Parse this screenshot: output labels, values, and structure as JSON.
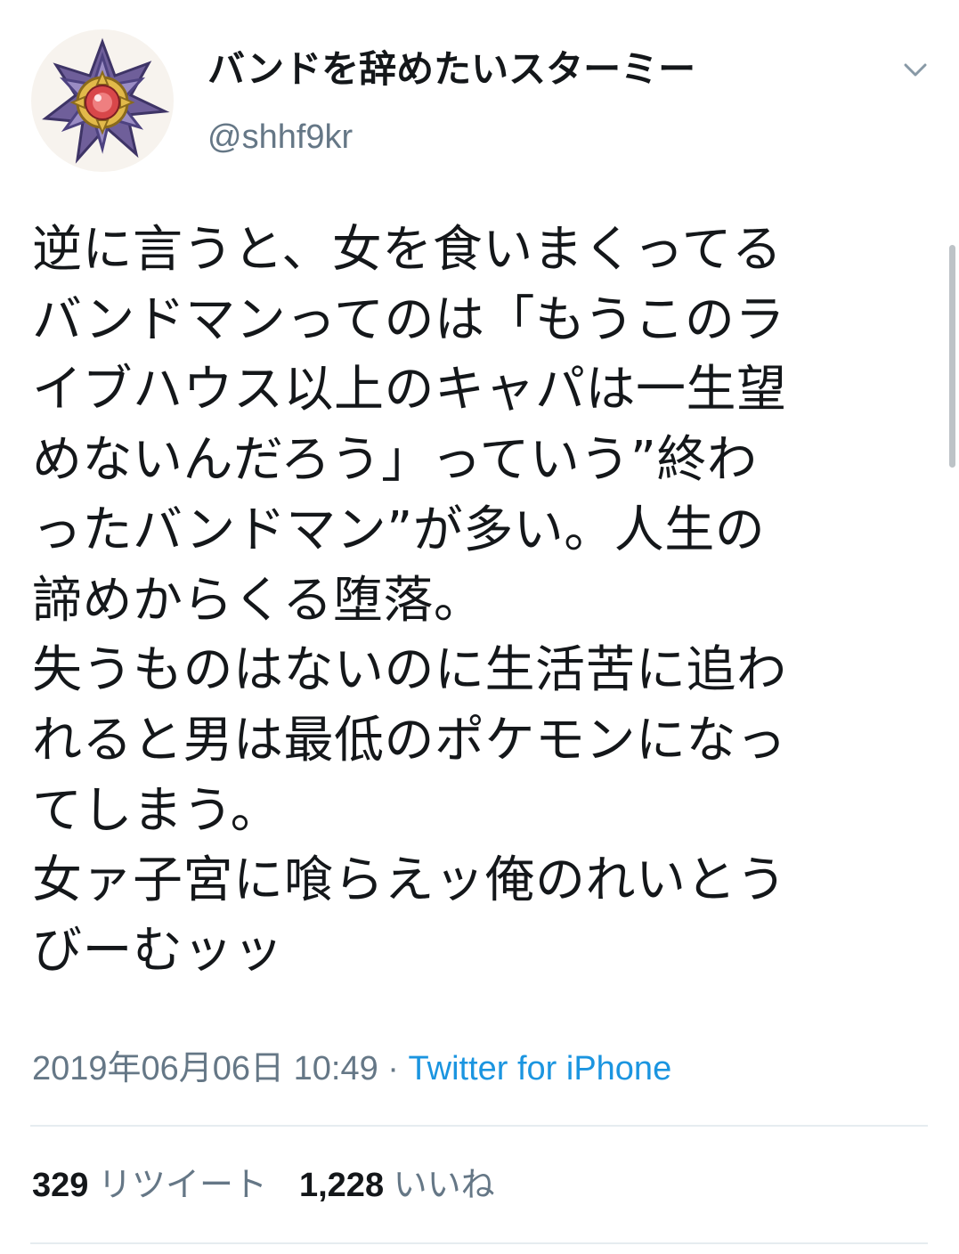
{
  "user": {
    "display_name": "バンドを辞めたいスターミー",
    "handle": "@shhf9kr",
    "avatar": "starmie-avatar"
  },
  "menu": {
    "icon": "chevron-down-icon"
  },
  "tweet": {
    "lines": [
      "逆に言うと、女を食いまくってる",
      "バンドマンってのは「もうこのラ",
      "イブハウス以上のキャパは一生望",
      "めないんだろう」っていう”終わ",
      "ったバンドマン”が多い。人生の",
      "諦めからくる堕落。",
      "失うものはないのに生活苦に追わ",
      "れると男は最低のポケモンになっ",
      "てしまう。",
      "女ァ子宮に喰らえッ俺のれいとう",
      "びーむッッ"
    ],
    "timestamp": "2019年06月06日 10:49",
    "separator": " · ",
    "source": "Twitter for iPhone"
  },
  "stats": {
    "retweet_count": "329",
    "retweet_label": "リツイート",
    "like_count": "1,228",
    "like_label": "いいね"
  },
  "colors": {
    "text": "#14171a",
    "secondary": "#657786",
    "link": "#1b95e0",
    "divider": "#e6ecf0"
  }
}
